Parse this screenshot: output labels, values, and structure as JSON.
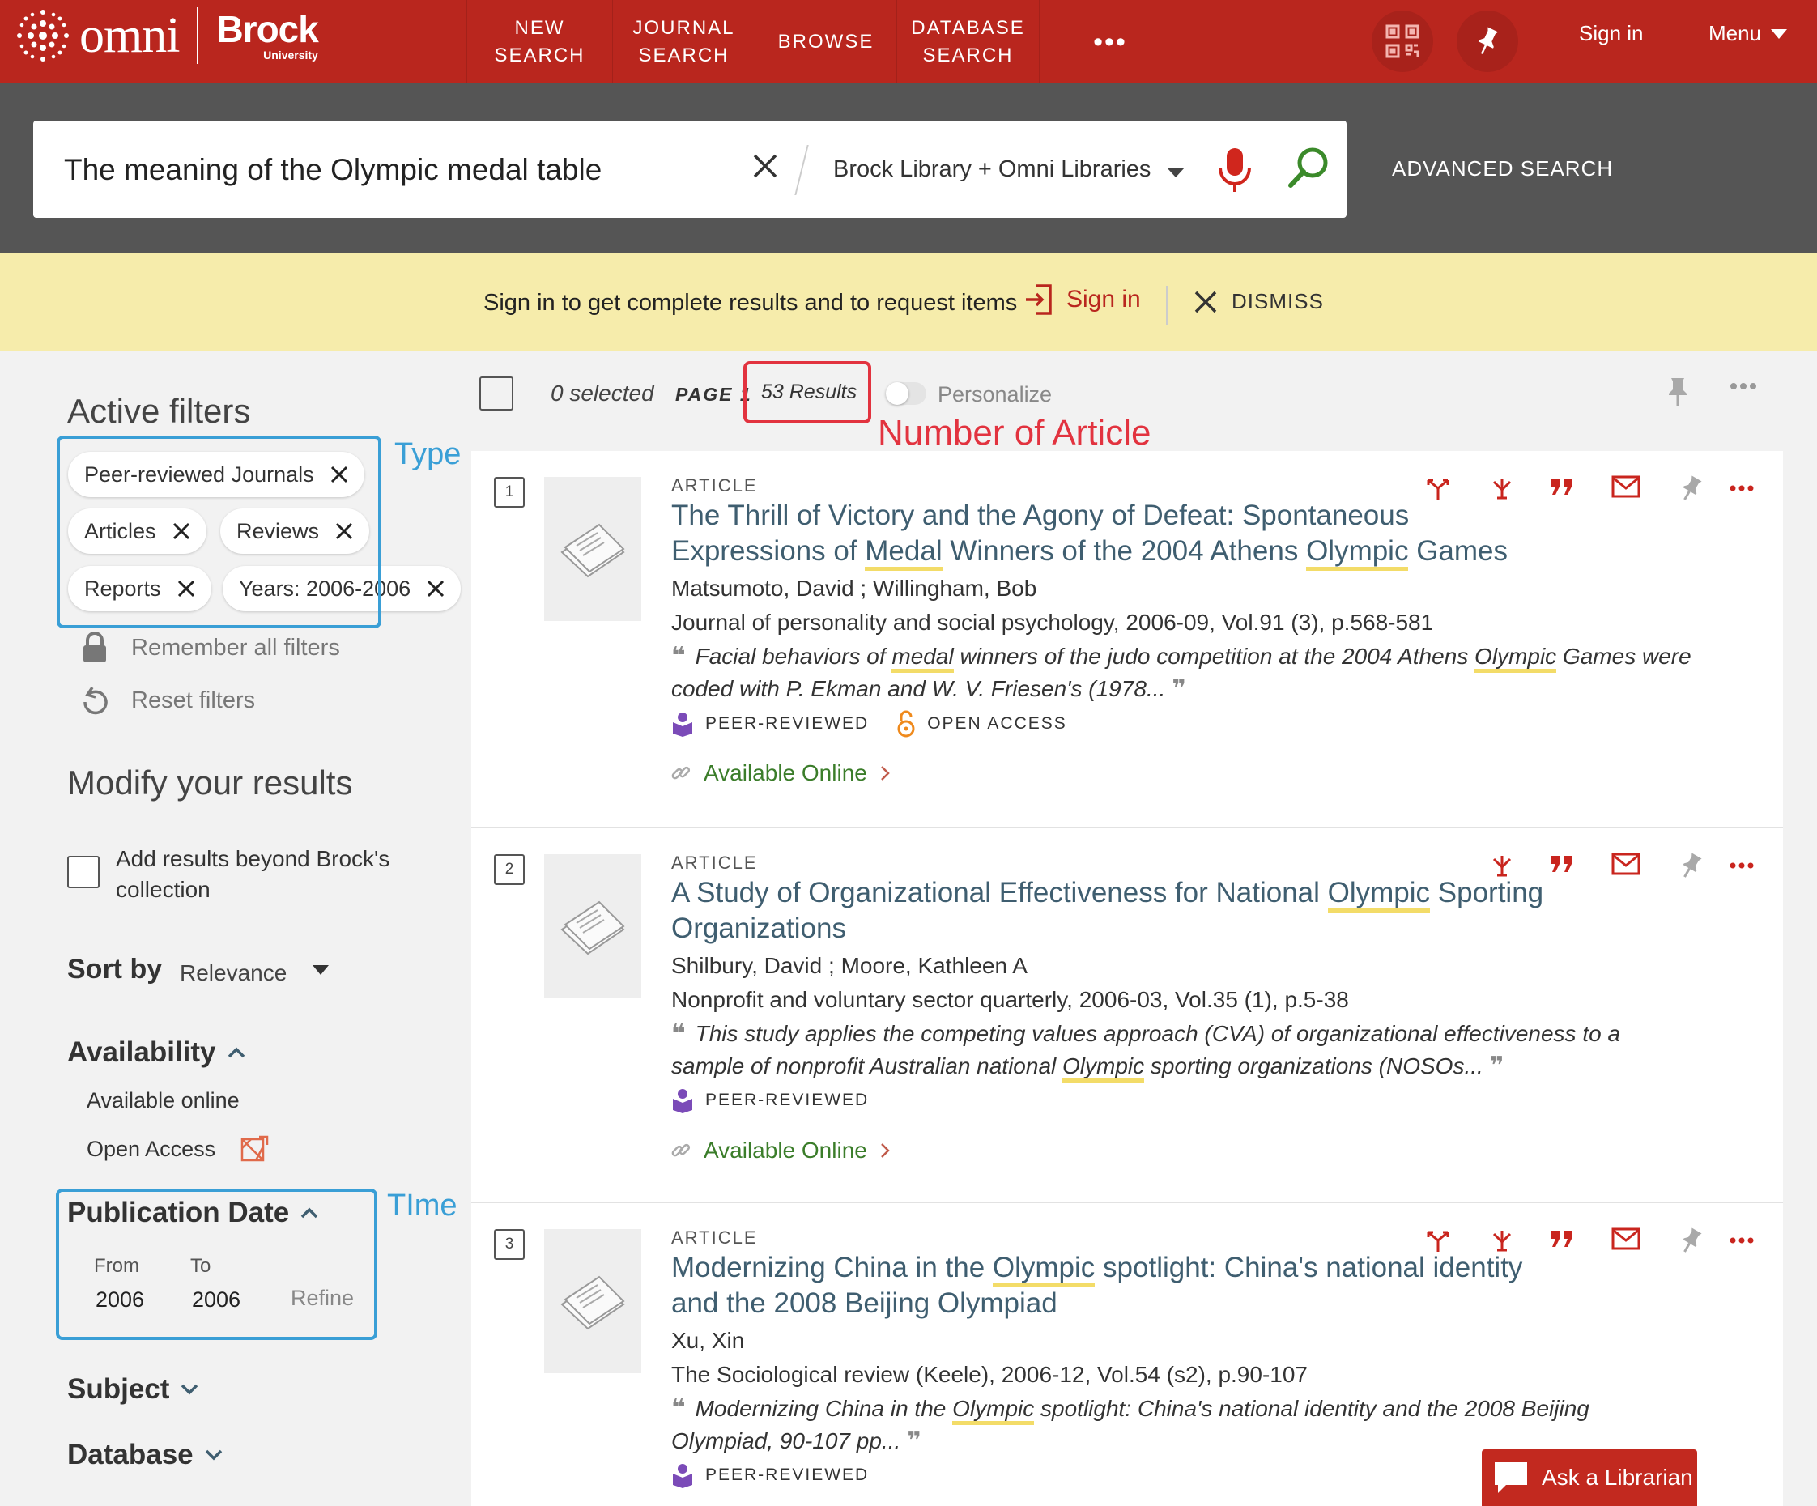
{
  "header": {
    "logo_omni": "omni",
    "logo_brock": "Brock",
    "logo_brock_sub": "University",
    "nav": [
      {
        "label": "NEW\nSEARCH"
      },
      {
        "label": "JOURNAL\nSEARCH"
      },
      {
        "label": "BROWSE"
      },
      {
        "label": "DATABASE\nSEARCH"
      },
      {
        "label": "•••"
      }
    ],
    "sign_in": "Sign in",
    "menu": "Menu"
  },
  "search": {
    "query": "The meaning of the Olympic medal table",
    "scope": "Brock Library + Omni Libraries",
    "advanced": "ADVANCED SEARCH"
  },
  "banner": {
    "text": "Sign in to get complete results and to request items",
    "sign_in": "Sign in",
    "dismiss": "DISMISS"
  },
  "sidebar": {
    "active_filters_title": "Active filters",
    "chips": [
      "Peer-reviewed Journals",
      "Articles",
      "Reviews",
      "Reports",
      "Years: 2006-2006"
    ],
    "remember": "Remember all filters",
    "reset": "Reset filters",
    "modify_title": "Modify your results",
    "add_beyond": "Add results beyond Brock's collection",
    "sort_label": "Sort by",
    "sort_value": "Relevance",
    "availability": "Availability",
    "available_online": "Available online",
    "open_access": "Open Access",
    "pub_date": "Publication Date",
    "from_label": "From",
    "to_label": "To",
    "from_value": "2006",
    "to_value": "2006",
    "refine": "Refine",
    "subject": "Subject",
    "database": "Database"
  },
  "annotations": {
    "type": "Type",
    "time": "TIme",
    "number_of_article": "Number of Article"
  },
  "toolbar": {
    "selected": "0 selected",
    "page": "PAGE 1",
    "results": "53 Results",
    "personalize": "Personalize"
  },
  "results": [
    {
      "num": "1",
      "type": "ARTICLE",
      "title_parts": [
        "The Thrill of Victory and the Agony of Defeat: Spontaneous Expressions of ",
        "Medal",
        " Winners of the 2004 Athens ",
        "Olympic",
        " Games"
      ],
      "authors": "Matsumoto, David ; Willingham, Bob",
      "source": "Journal of personality and social psychology, 2006-09, Vol.91 (3), p.568-581",
      "snippet_parts": [
        "Facial behaviors of ",
        "medal",
        " winners of the judo competition at the 2004 Athens ",
        "Olympic",
        " Games were coded with P. Ekman and W. V. Friesen's (1978..."
      ],
      "peer": "PEER-REVIEWED",
      "open_access": "OPEN ACCESS",
      "availability": "Available Online"
    },
    {
      "num": "2",
      "type": "ARTICLE",
      "title_parts": [
        "A Study of Organizational Effectiveness for National ",
        "Olympic",
        " Sporting Organizations"
      ],
      "authors": "Shilbury, David ; Moore, Kathleen A",
      "source": "Nonprofit and voluntary sector quarterly, 2006-03, Vol.35 (1), p.5-38",
      "snippet_parts": [
        "This study applies the competing values approach (CVA) of organizational effectiveness to a sample of nonprofit Australian national ",
        "Olympic",
        " sporting organizations (NOSOs..."
      ],
      "peer": "PEER-REVIEWED",
      "availability": "Available Online"
    },
    {
      "num": "3",
      "type": "ARTICLE",
      "title_parts": [
        "Modernizing China in the ",
        "Olympic",
        " spotlight: China's national identity and the 2008 Beijing Olympiad"
      ],
      "authors": "Xu, Xin",
      "source": "The Sociological review (Keele), 2006-12, Vol.54 (s2), p.90-107",
      "snippet_parts": [
        "Modernizing China in the ",
        "Olympic",
        " spotlight: China's national identity and the 2008 Beijing Olympiad, 90-107 pp..."
      ],
      "peer": "PEER-REVIEWED"
    }
  ],
  "ask_librarian": "Ask a Librarian",
  "colors": {
    "brand_red": "#b9261e",
    "link_title": "#3f5e70",
    "annotation_blue": "#3a9fd6",
    "annotation_red": "#e2333f",
    "available_green": "#3b7d2a"
  }
}
